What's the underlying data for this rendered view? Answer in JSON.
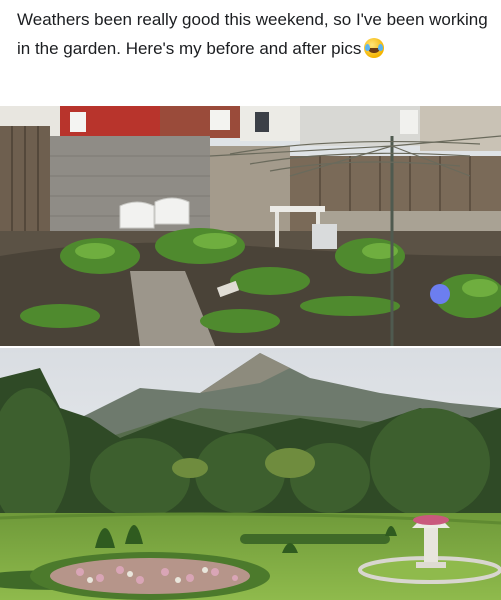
{
  "post": {
    "caption": "Weathers been really good this weekend, so I've been working in the garden. Here's my before and after pics",
    "emoji": "laughing-with-tears-emoji"
  },
  "photos": [
    {
      "id": "before",
      "subject": "overgrown backyard with washing line and plastic chairs"
    },
    {
      "id": "after",
      "subject": "formal landscaped garden with topiary and mountain view"
    }
  ],
  "colors": {
    "text": "#1c1e21",
    "background": "#ffffff"
  }
}
